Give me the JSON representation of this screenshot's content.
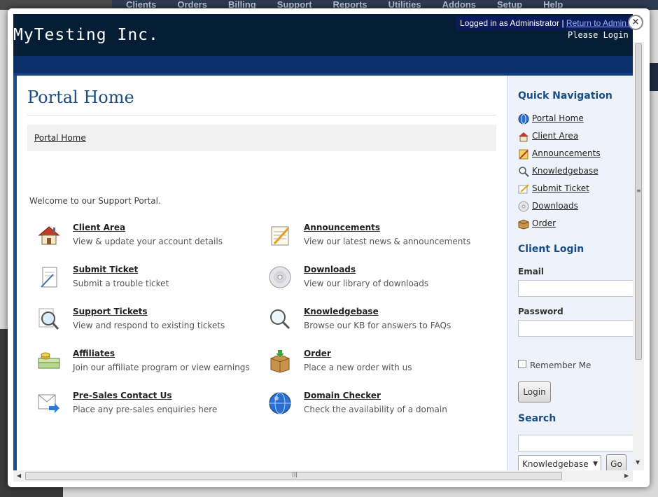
{
  "background": {
    "nav": [
      "Clients",
      "Orders",
      "Billing",
      "Support",
      "Reports",
      "Utilities",
      "Addons",
      "Setup",
      "Help"
    ]
  },
  "header": {
    "brand": "MyTesting Inc.",
    "logged_in": "Logged in as Administrator",
    "separator": "|",
    "return_link": "Return to Admin Area",
    "please_login": "Please Login"
  },
  "main": {
    "title": "Portal Home",
    "breadcrumb": "Portal Home",
    "welcome": "Welcome to our Support Portal.",
    "tiles": [
      {
        "title": "Client Area",
        "desc": "View & update your account details",
        "icon": "house-icon"
      },
      {
        "title": "Announcements",
        "desc": "View our latest news & announcements",
        "icon": "notepad-icon"
      },
      {
        "title": "Submit Ticket",
        "desc": "Submit a trouble ticket",
        "icon": "pen-paper-icon"
      },
      {
        "title": "Downloads",
        "desc": "View our library of downloads",
        "icon": "cd-icon"
      },
      {
        "title": "Support Tickets",
        "desc": "View and respond to existing tickets",
        "icon": "magnifier-document-icon"
      },
      {
        "title": "Knowledgebase",
        "desc": "Browse our KB for answers to FAQs",
        "icon": "magnifier-icon"
      },
      {
        "title": "Affiliates",
        "desc": "Join our affiliate program or view earnings",
        "icon": "money-icon"
      },
      {
        "title": "Order",
        "desc": "Place a new order with us",
        "icon": "box-icon"
      },
      {
        "title": "Pre-Sales Contact Us",
        "desc": "Place any pre-sales enquiries here",
        "icon": "mail-arrow-icon"
      },
      {
        "title": "Domain Checker",
        "desc": "Check the availability of a domain",
        "icon": "globe-icon"
      }
    ]
  },
  "sidebar": {
    "quick_nav_title": "Quick Navigation",
    "quick_nav": [
      {
        "label": "Portal Home",
        "icon": "globe-icon"
      },
      {
        "label": "Client Area",
        "icon": "house-icon"
      },
      {
        "label": "Announcements",
        "icon": "notepad-icon"
      },
      {
        "label": "Knowledgebase",
        "icon": "magnifier-icon"
      },
      {
        "label": "Submit Ticket",
        "icon": "pen-paper-icon"
      },
      {
        "label": "Downloads",
        "icon": "cd-icon"
      },
      {
        "label": "Order",
        "icon": "box-icon"
      }
    ],
    "client_login_title": "Client Login",
    "email_label": "Email",
    "email_value": "",
    "password_label": "Password",
    "password_value": "",
    "remember_me": "Remember Me",
    "login_button": "Login",
    "search_title": "Search",
    "search_value": "",
    "search_select": "Knowledgebase",
    "go_button": "Go"
  },
  "close_symbol": "×"
}
